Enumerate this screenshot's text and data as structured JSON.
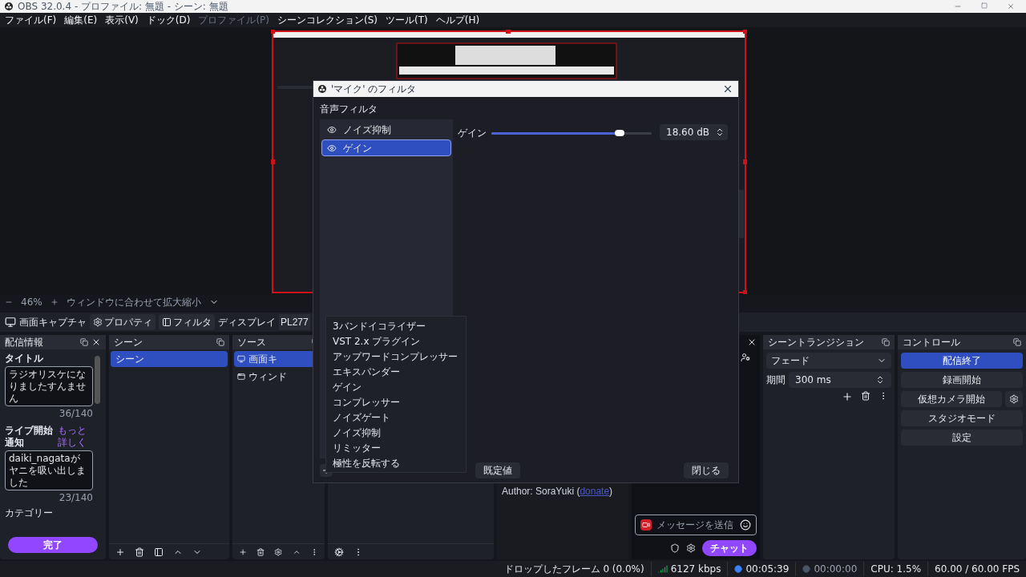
{
  "window": {
    "title": "OBS 32.0.4 - プロファイル: 無題 - シーン: 無題"
  },
  "menu": [
    {
      "label": "ファイル(F)",
      "disabled": false
    },
    {
      "label": "編集(E)",
      "disabled": false
    },
    {
      "label": "表示(V)",
      "disabled": false
    },
    {
      "label": "ドック(D)",
      "disabled": false
    },
    {
      "label": "プロファイル(P)",
      "disabled": true
    },
    {
      "label": "シーンコレクション(S)",
      "disabled": false
    },
    {
      "label": "ツール(T)",
      "disabled": false
    },
    {
      "label": "ヘルプ(H)",
      "disabled": false
    }
  ],
  "preview_bar": {
    "zoom": "46%",
    "fit": "ウィンドウに合わせて拡大縮小"
  },
  "source_toolbar": {
    "source": "画面キャプチャ",
    "properties": "プロパティ",
    "filters": "フィルタ",
    "display_label": "ディスプレイ",
    "display_value": "PL277"
  },
  "stream_info": {
    "title": "配信情報",
    "title_label": "タイトル",
    "title_value": "ラジオリスケになりましたすんません",
    "title_count": "36/140",
    "notify_label": "ライブ開始通知",
    "more_link": "もっと詳しく",
    "notify_value": "daiki_nagataがヤニを吸い出しました",
    "notify_count": "23/140",
    "category_label": "カテゴリー",
    "done": "完了"
  },
  "scenes": {
    "title": "シーン",
    "items": [
      {
        "label": "シーン",
        "selected": true
      }
    ]
  },
  "sources": {
    "title": "ソース",
    "items": [
      {
        "label": "画面キ",
        "kind": "display",
        "selected": true
      },
      {
        "label": "ウィンド",
        "kind": "window",
        "selected": false
      }
    ]
  },
  "plugin_info": {
    "author": "Author: SoraYuki (",
    "link": "donate",
    "after": ")"
  },
  "chat": {
    "placeholder": "メッセージを送信",
    "button": "チャット"
  },
  "transitions": {
    "title": "シーントランジション",
    "transition": "フェード",
    "duration_label": "期間",
    "duration": "300 ms"
  },
  "controls": {
    "title": "コントロール",
    "buttons": [
      {
        "label": "配信終了",
        "active": true,
        "kind": "plain"
      },
      {
        "label": "録画開始",
        "active": false,
        "kind": "plain"
      },
      {
        "label": "仮想カメラ開始",
        "active": false,
        "kind": "split"
      },
      {
        "label": "スタジオモード",
        "active": false,
        "kind": "plain"
      },
      {
        "label": "設定",
        "active": false,
        "kind": "plain"
      }
    ]
  },
  "dialog": {
    "title": "'マイク' のフィルタ",
    "section": "音声フィルタ",
    "filters": [
      {
        "label": "ノイズ抑制",
        "selected": false
      },
      {
        "label": "ゲイン",
        "selected": true
      }
    ],
    "gain_label": "ゲイン",
    "gain": {
      "level": 0.8
    },
    "gain_value": "18.60 dB",
    "defaults": "既定値",
    "close": "閉じる",
    "add_menu": [
      "3バンドイコライザー",
      "VST 2.x プラグイン",
      "アップワードコンプレッサー",
      "エキスパンダー",
      "ゲイン",
      "コンプレッサー",
      "ノイズゲート",
      "ノイズ抑制",
      "リミッター",
      "極性を反転する"
    ]
  },
  "status_bar": {
    "dropped": "ドロップしたフレーム 0 (0.0%)",
    "bitrate": "6127 kbps",
    "stream_time": "00:05:39",
    "streaming": true,
    "record_time": "00:00:00",
    "recording": false,
    "cpu": "CPU: 1.5%",
    "fps": "60.00 / 60.00 FPS"
  }
}
